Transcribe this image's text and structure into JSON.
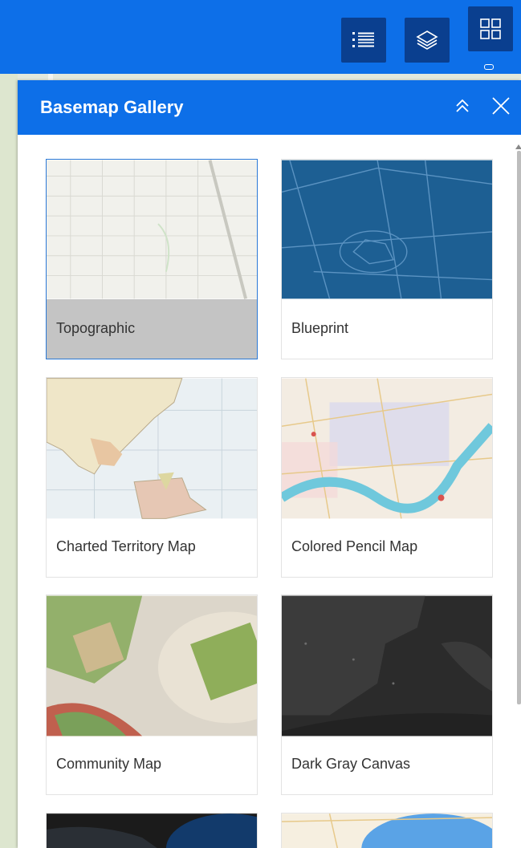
{
  "toolbar": {
    "buttons": [
      {
        "name": "legend",
        "icon": "list-icon"
      },
      {
        "name": "layer-list",
        "icon": "layers-icon"
      },
      {
        "name": "basemap-gallery",
        "icon": "grid-icon"
      }
    ]
  },
  "panel": {
    "title": "Basemap Gallery",
    "collapse_icon": "double-chevron-up-icon",
    "close_icon": "close-icon"
  },
  "basemaps": [
    {
      "label": "Topographic",
      "selected": true
    },
    {
      "label": "Blueprint",
      "selected": false
    },
    {
      "label": "Charted Territory Map",
      "selected": false
    },
    {
      "label": "Colored Pencil Map",
      "selected": false
    },
    {
      "label": "Community Map",
      "selected": false
    },
    {
      "label": "Dark Gray Canvas",
      "selected": false
    }
  ],
  "colors": {
    "header": "#0d6fe8",
    "button_dark": "#0a3f8f",
    "selected_caption": "#c4c4c4",
    "selected_border": "#2a78d6"
  }
}
